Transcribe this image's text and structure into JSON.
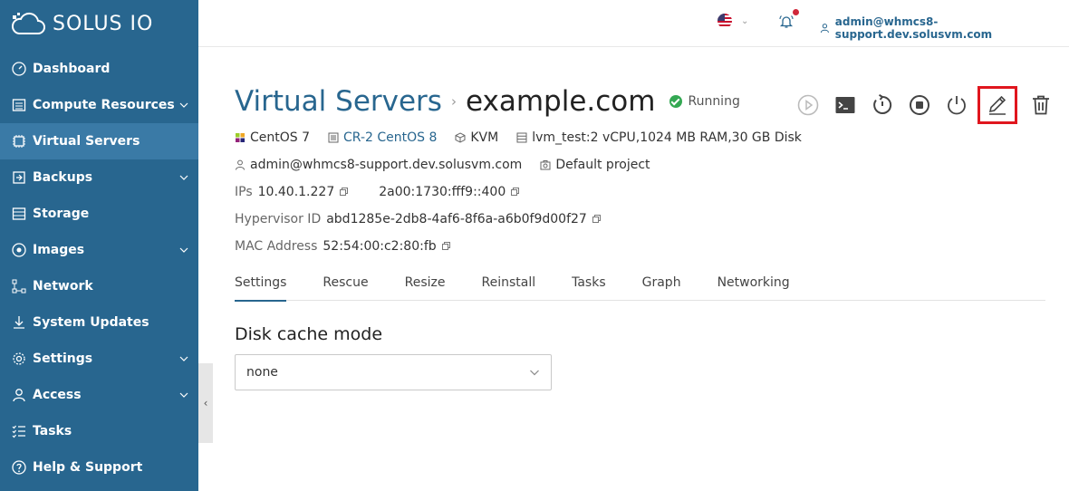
{
  "brand": {
    "name": "SOLUS IO"
  },
  "sidebar": {
    "items": [
      {
        "label": "Dashboard",
        "icon": "dashboard-icon",
        "expandable": false,
        "active": false
      },
      {
        "label": "Compute Resources",
        "icon": "server-list-icon",
        "expandable": true,
        "active": false
      },
      {
        "label": "Virtual Servers",
        "icon": "virtual-servers-icon",
        "expandable": false,
        "active": true
      },
      {
        "label": "Backups",
        "icon": "backup-icon",
        "expandable": true,
        "active": false
      },
      {
        "label": "Storage",
        "icon": "storage-icon",
        "expandable": false,
        "active": false
      },
      {
        "label": "Images",
        "icon": "images-icon",
        "expandable": true,
        "active": false
      },
      {
        "label": "Network",
        "icon": "network-icon",
        "expandable": false,
        "active": false
      },
      {
        "label": "System Updates",
        "icon": "download-icon",
        "expandable": false,
        "active": false
      },
      {
        "label": "Settings",
        "icon": "gear-icon",
        "expandable": true,
        "active": false
      },
      {
        "label": "Access",
        "icon": "user-icon",
        "expandable": true,
        "active": false
      },
      {
        "label": "Tasks",
        "icon": "tasks-icon",
        "expandable": false,
        "active": false
      },
      {
        "label": "Help & Support",
        "icon": "help-icon",
        "expandable": false,
        "active": false
      }
    ]
  },
  "header": {
    "language_icon": "us-flag-icon",
    "notifications_icon": "bell-icon",
    "user_email": "admin@whmcs8-support.dev.solusvm.com"
  },
  "page": {
    "breadcrumb_root": "Virtual Servers",
    "breadcrumb_sep": "›",
    "server_name": "example.com",
    "status": "Running",
    "status_color": "#34a853"
  },
  "server_info": {
    "os": "CentOS 7",
    "plan": "CR-2 CentOS 8",
    "virtualization": "KVM",
    "resources": "lvm_test:2 vCPU,1024 MB RAM,30 GB Disk",
    "owner": "admin@whmcs8-support.dev.solusvm.com",
    "project": "Default project",
    "ips_label": "IPs",
    "ipv4": "10.40.1.227",
    "ipv6": "2a00:1730:fff9::400",
    "hypervisor_label": "Hypervisor ID",
    "hypervisor_id": "abd1285e-2db8-4af6-8f6a-a6b0f9d00f27",
    "mac_label": "MAC Address",
    "mac": "52:54:00:c2:80:fb"
  },
  "tabs": [
    "Settings",
    "Rescue",
    "Resize",
    "Reinstall",
    "Tasks",
    "Graph",
    "Networking"
  ],
  "active_tab": "Settings",
  "settings": {
    "disk_cache_title": "Disk cache mode",
    "disk_cache_value": "none"
  },
  "colors": {
    "sidebar": "#28668f",
    "accent": "#28668f",
    "highlight": "#e0161e"
  }
}
